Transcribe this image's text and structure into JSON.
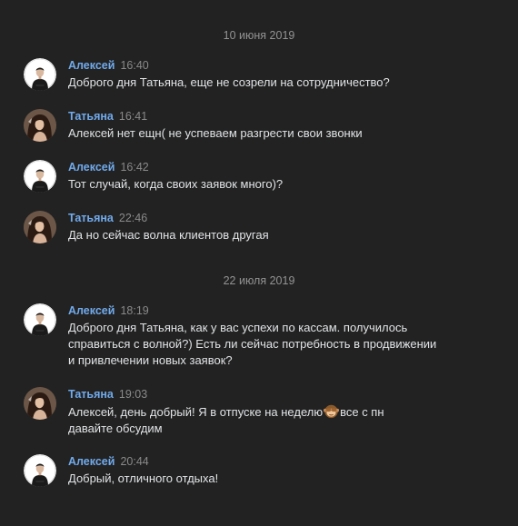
{
  "dates": [
    "10 июня 2019",
    "22 июля 2019"
  ],
  "colors": {
    "background": "#222222",
    "author": "#71aaeb",
    "text": "#e1e3e6",
    "meta": "#8a8a8a"
  },
  "messages": [
    {
      "author": "Алексей",
      "time": "16:40",
      "lines": [
        "Доброго дня Татьяна, еще не созрели на сотрудничество?"
      ]
    },
    {
      "author": "Татьяна",
      "time": "16:41",
      "lines": [
        "Алексей нет ещн( не успеваем разгрести свои звонки"
      ]
    },
    {
      "author": "Алексей",
      "time": "16:42",
      "lines": [
        "Тот случай, когда своих заявок много)?"
      ]
    },
    {
      "author": "Татьяна",
      "time": "22:46",
      "lines": [
        "Да но сейчас волна клиентов другая"
      ]
    },
    {
      "author": "Алексей",
      "time": "18:19",
      "lines": [
        "Доброго дня Татьяна, как у вас успехи по кассам. получилось",
        "справиться с волной?) Есть ли сейчас потребность в продвижении",
        "и привлечении новых заявок?"
      ]
    },
    {
      "author": "Татьяна",
      "time": "19:03",
      "lines_part": {
        "before": "Алексей, день добрый! Я в отпуске на неделю",
        "emoji": "see-no-evil-monkey-emoji",
        "after": "все с пн"
      },
      "lines": [
        "давайте обсудим"
      ]
    },
    {
      "author": "Алексей",
      "time": "20:44",
      "lines": [
        "Добрый, отличного отдыха!"
      ]
    }
  ]
}
